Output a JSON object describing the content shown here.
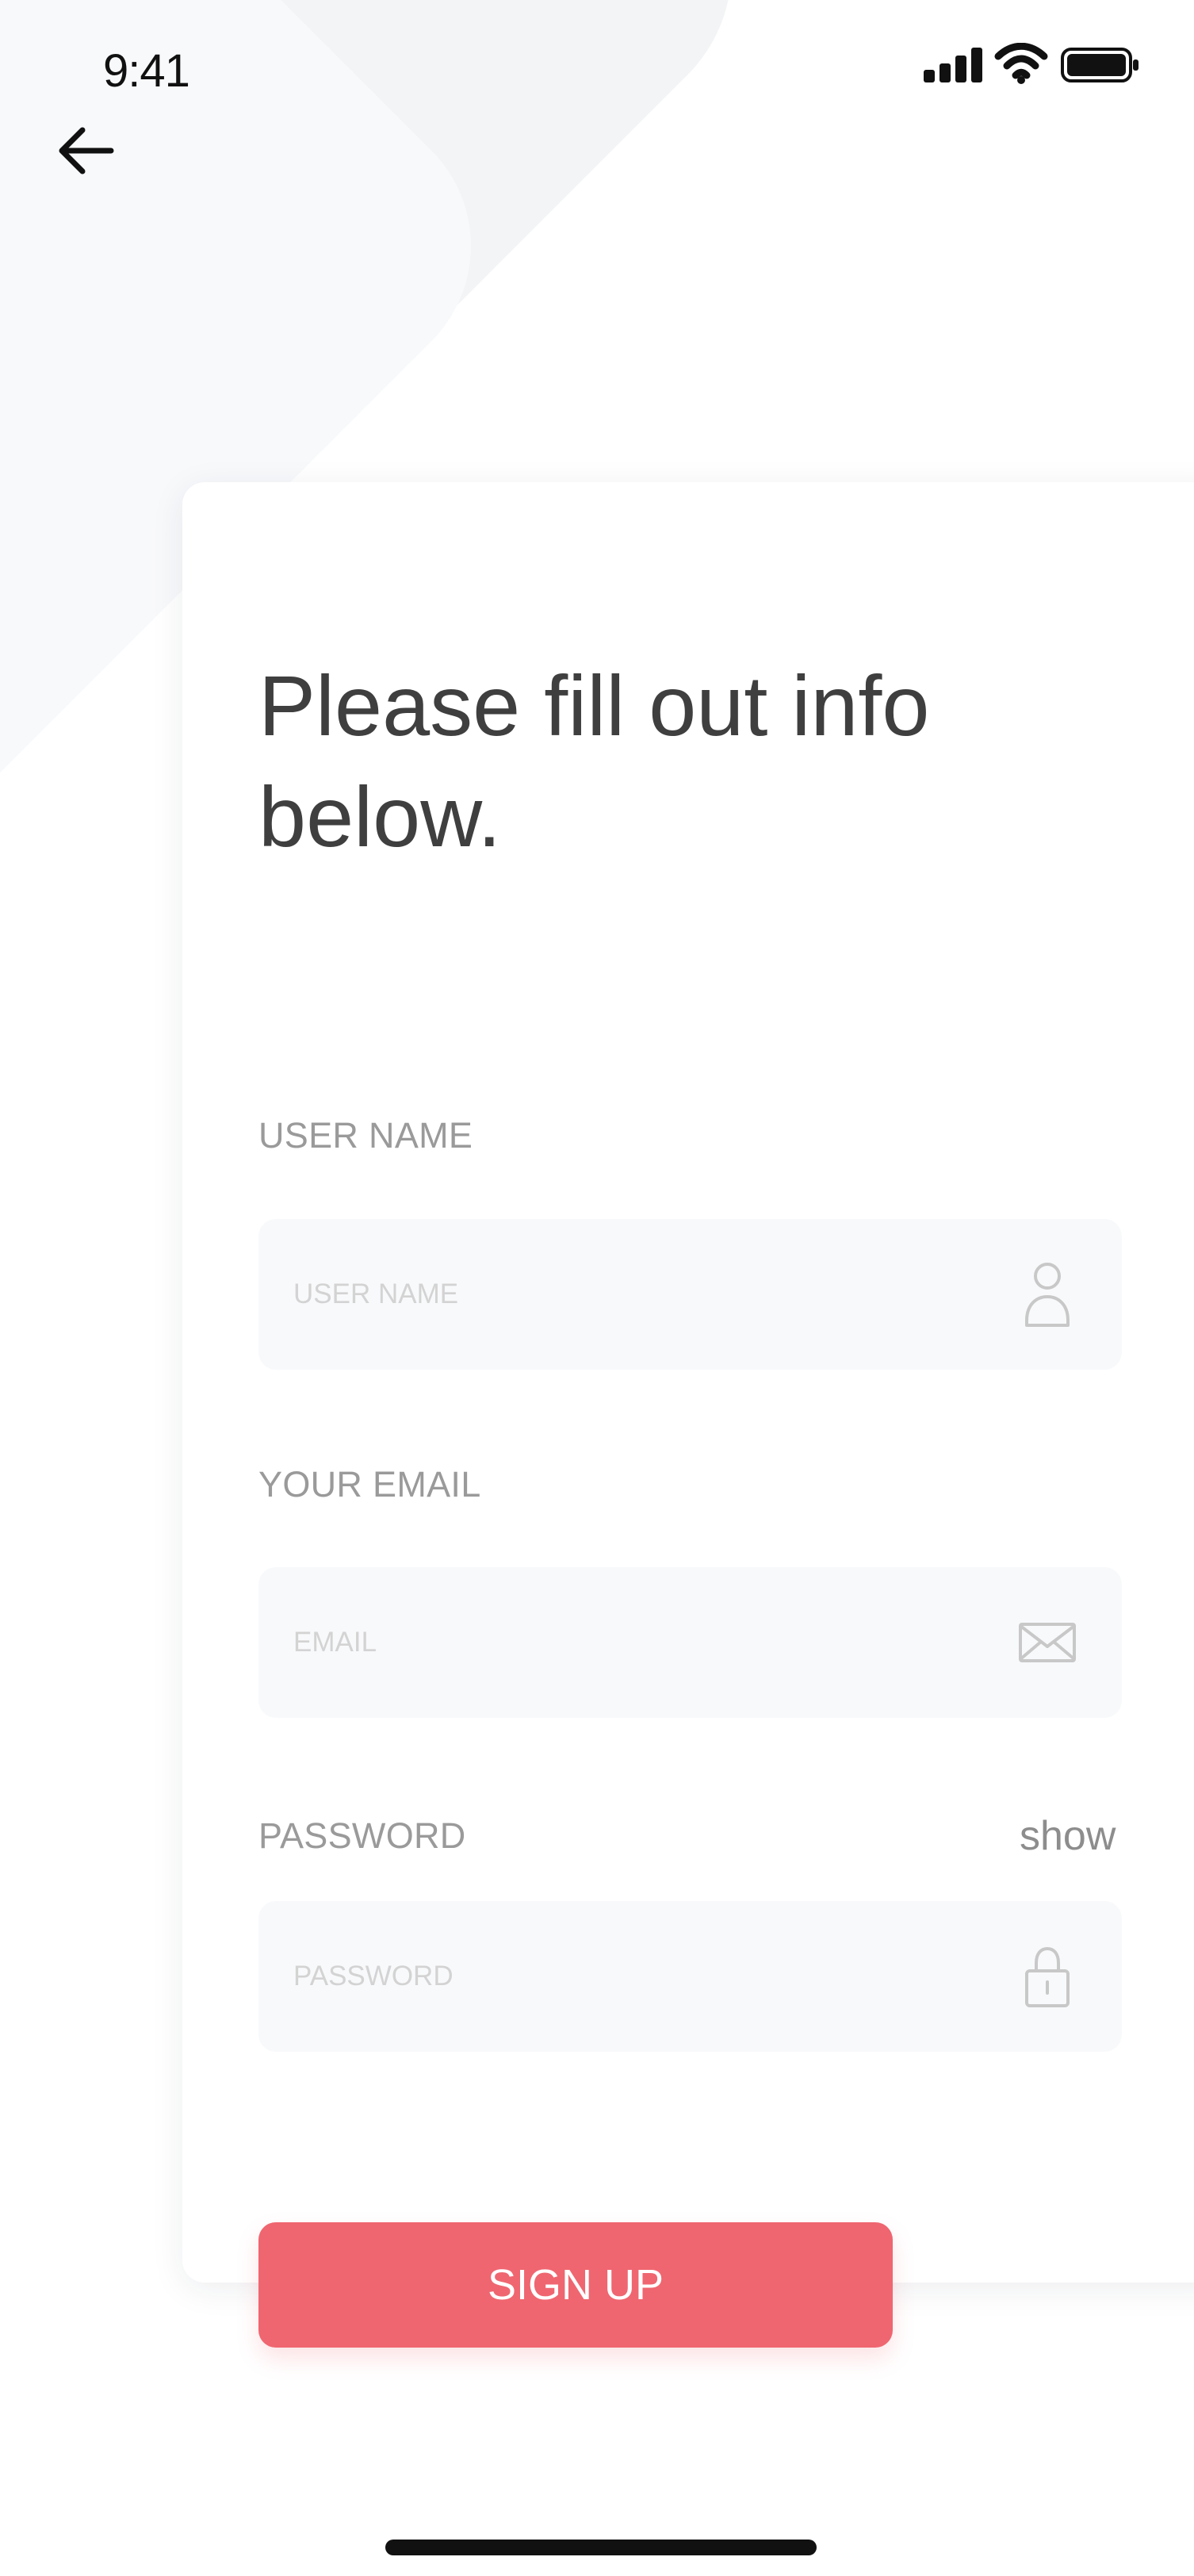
{
  "status_bar": {
    "time": "9:41"
  },
  "icons": {
    "back": "arrow-left-icon",
    "signal": "cellular-signal-icon",
    "wifi": "wifi-icon",
    "battery": "battery-icon",
    "user": "user-icon",
    "email": "mail-icon",
    "password": "lock-icon"
  },
  "form": {
    "title": "Please fill out info below.",
    "username": {
      "label": "USER NAME",
      "placeholder": "USER NAME",
      "value": ""
    },
    "email": {
      "label": "YOUR EMAIL",
      "placeholder": "EMAIL",
      "value": ""
    },
    "password": {
      "label": "PASSWORD",
      "placeholder": "PASSWORD",
      "value": "",
      "show_label": "show"
    },
    "submit_label": "SIGN UP"
  },
  "colors": {
    "primary": "#ef6670",
    "title": "#3f3f3f",
    "label": "#9a9a9a",
    "input_background": "#f8f9fb",
    "icon": "#c8c8c8"
  }
}
